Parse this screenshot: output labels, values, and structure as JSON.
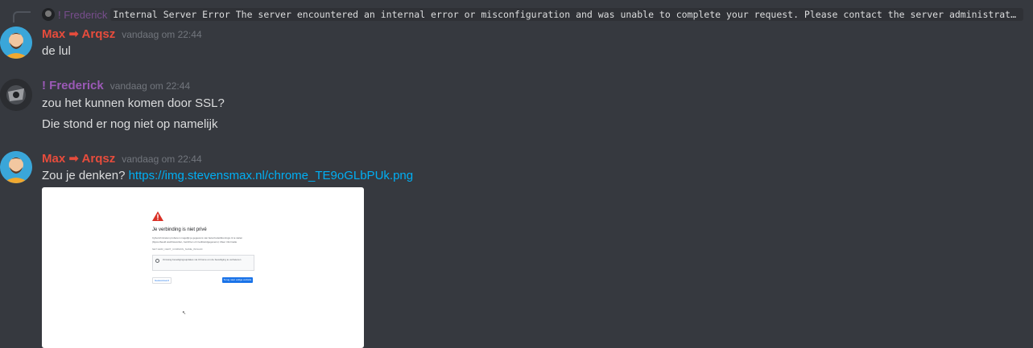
{
  "reply": {
    "author": "! Frederick",
    "content": "Internal Server Error The server encountered an internal error or misconfiguration and was unable to complete your request.  Please contact the server administrator at web..."
  },
  "messages": [
    {
      "author": "Max ➡ Arqsz",
      "timestamp": "vandaag om 22:44",
      "lines": [
        "de lul"
      ]
    },
    {
      "author": "! Frederick",
      "timestamp": "vandaag om 22:44",
      "lines": [
        "zou het kunnen komen door SSL?",
        "Die stond er nog niet op namelijk"
      ]
    },
    {
      "author": "Max ➡ Arqsz",
      "timestamp": "vandaag om 22:44",
      "text": "Zou je denken?",
      "link": "https://img.stevensmax.nl/chrome_TE9oGLbPUk.png"
    }
  ],
  "embed": {
    "heading": "Je verbinding is niet privé",
    "body": "Cybercriminelen proberen mogelijk je gegevens van beta.frederikkonings.nl te stelen (bijvoorbeeld wachtwoorden, berichten of creditcardgegevens). Meer informatie",
    "error_code": "NET::ERR_CERT_COMMON_NAME_INVALID",
    "notice": "Ontvang beveiligingsupdates via Chrome om de beveiliging te verbeteren",
    "advanced_button": "Geavanceerd",
    "back_button": "Terug naar veilige website"
  },
  "colors": {
    "background": "#36393f",
    "max_role": "#e74c3c",
    "frederick_role": "#9b59b6",
    "link": "#00aff4"
  }
}
